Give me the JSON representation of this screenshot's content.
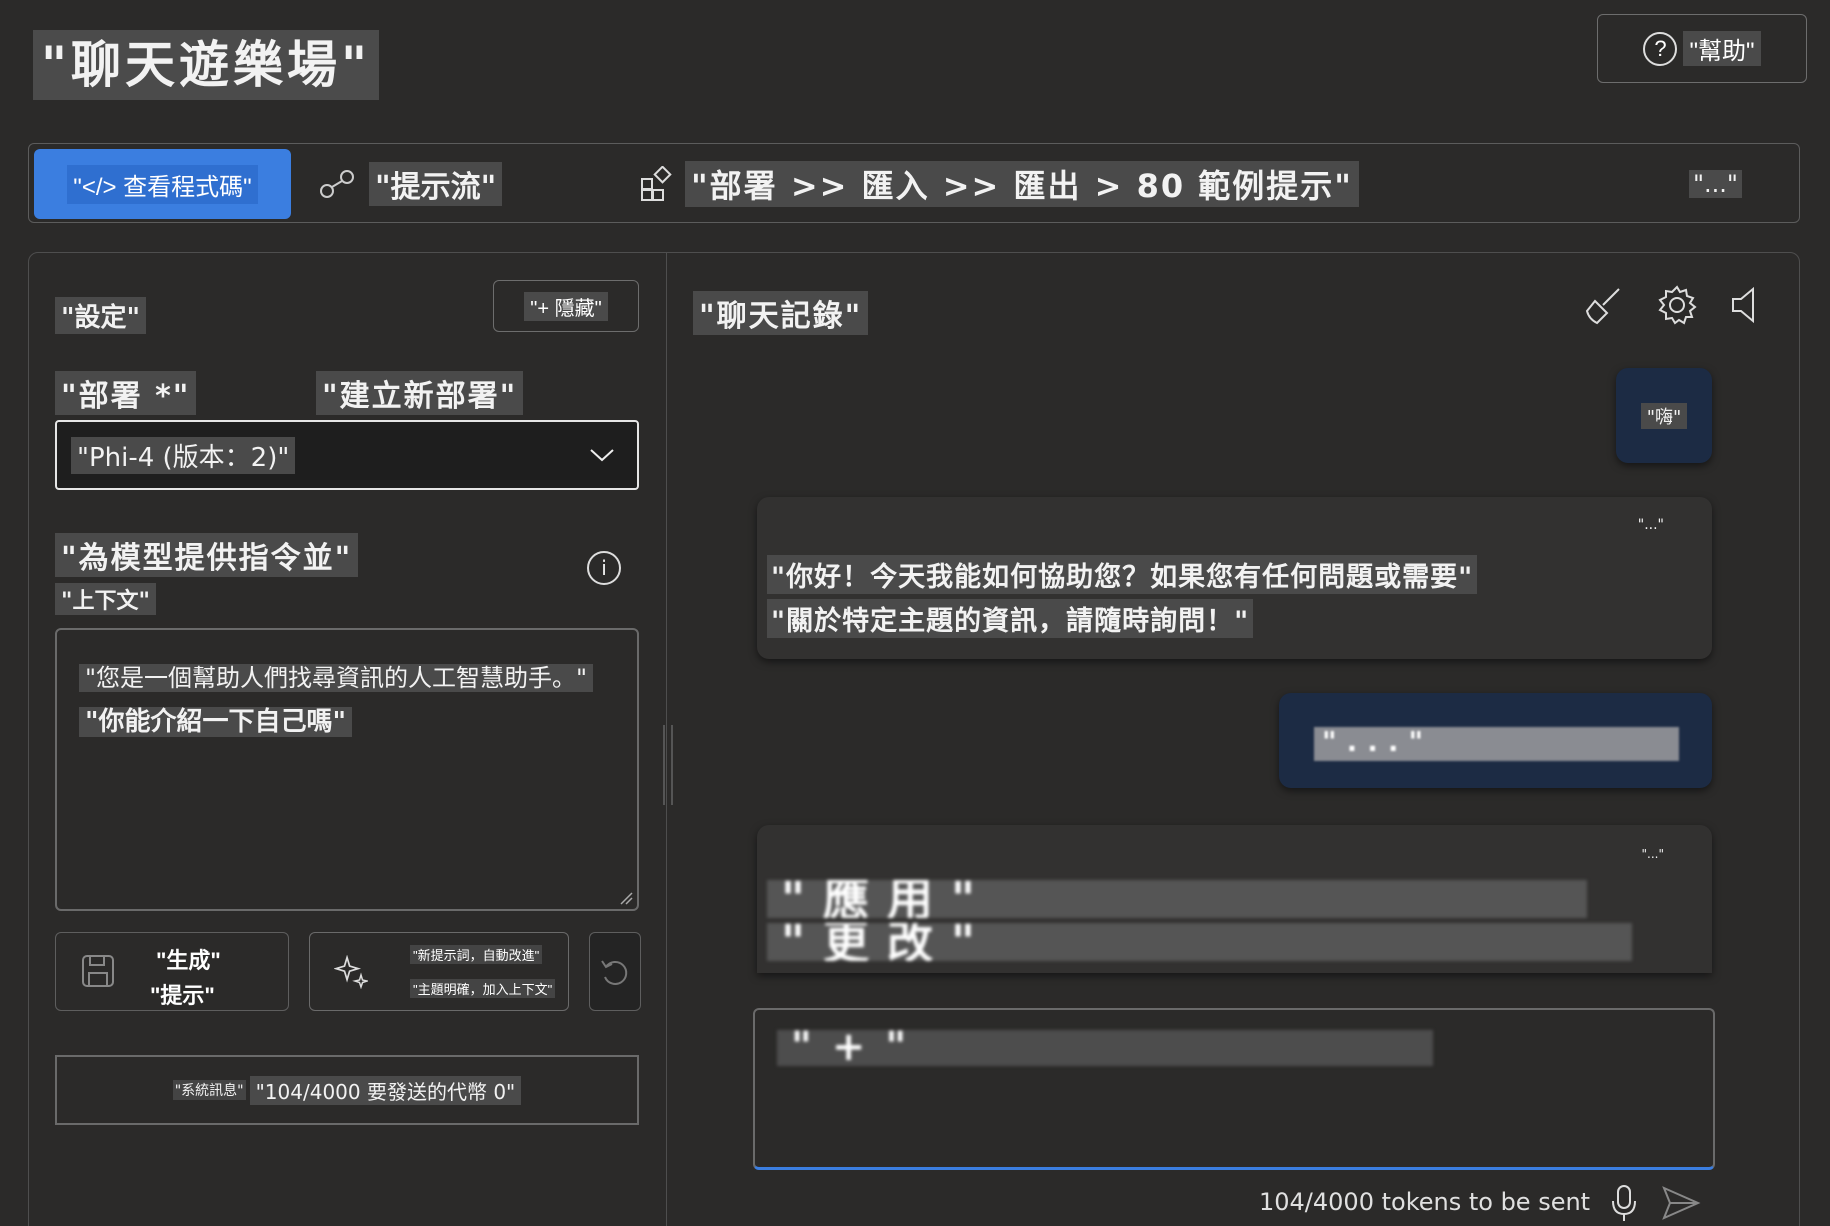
{
  "header": {
    "title": "\"聊天遊樂場\"",
    "help_label": "\"幫助\"",
    "help_icon": "question-circle-icon"
  },
  "toolbar": {
    "view_code_label": "\"</> 查看程式碼\"",
    "prompt_flow_label": "\"提示流\"",
    "deploy_label": "\"部署 >> 匯入 >> 匯出 > 80 範例提示\"",
    "more_label": "\"...\""
  },
  "settings": {
    "title": "\"設定\"",
    "hide_label": "\"+ 隱藏\"",
    "deployment_label": "\"部署 *\"",
    "new_deployment_label": "\"建立新部署\"",
    "deployment_value": "\"Phi-4 (版本：2)\"",
    "instructions_label": "\"為模型提供指令並\"",
    "context_label": "\"上下文\"",
    "system_message_line1": "\"您是一個幫助人們找尋資訊的人工智慧助手。\"",
    "system_message_line2": "\"你能介紹一下自己嗎\"",
    "generate_line1": "\"生成\"",
    "generate_line2": "\"提示\"",
    "improve_line1": "\"新提示詞，自動改進\"",
    "improve_line2": "\"主題明確，加入上下文\"",
    "token_prefix": "\"系統訊息\"",
    "token_count": "\"104/4000 要發送的代幣 0\""
  },
  "chat": {
    "title": "\"聊天記錄\"",
    "messages": [
      {
        "role": "user",
        "text": "\"嗨\""
      },
      {
        "role": "assistant",
        "more": "\"...\"",
        "line1": "\"你好！今天我能如何協助您？如果您有任何問題或需要\"",
        "line2": "\"關於特定主題的資訊，請隨時詢問！\""
      },
      {
        "role": "user",
        "text": "\"...\""
      },
      {
        "role": "assistant",
        "more": "\"...\"",
        "line1": "\"應用\"",
        "line2": "\"更改\""
      }
    ],
    "input_value": "\"+\"",
    "token_count": "104/4000 tokens to be sent"
  }
}
